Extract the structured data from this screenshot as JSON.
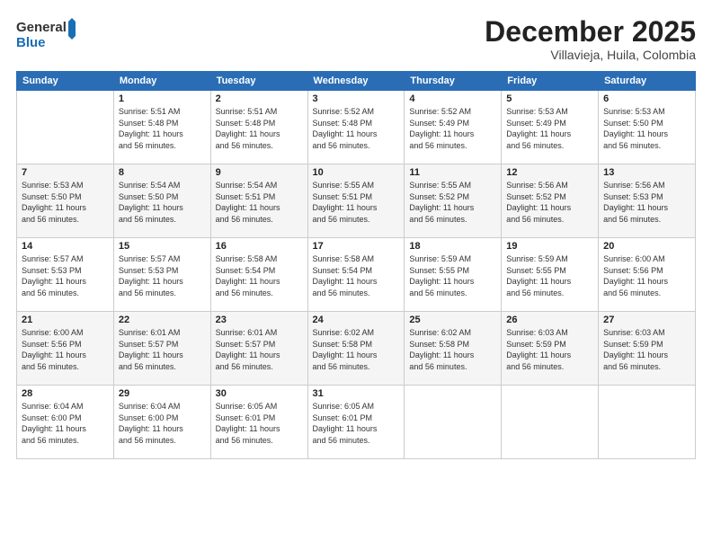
{
  "logo": {
    "line1": "General",
    "line2": "Blue"
  },
  "title": "December 2025",
  "subtitle": "Villavieja, Huila, Colombia",
  "weekdays": [
    "Sunday",
    "Monday",
    "Tuesday",
    "Wednesday",
    "Thursday",
    "Friday",
    "Saturday"
  ],
  "rows": [
    [
      {
        "day": "",
        "info": ""
      },
      {
        "day": "1",
        "info": "Sunrise: 5:51 AM\nSunset: 5:48 PM\nDaylight: 11 hours\nand 56 minutes."
      },
      {
        "day": "2",
        "info": "Sunrise: 5:51 AM\nSunset: 5:48 PM\nDaylight: 11 hours\nand 56 minutes."
      },
      {
        "day": "3",
        "info": "Sunrise: 5:52 AM\nSunset: 5:48 PM\nDaylight: 11 hours\nand 56 minutes."
      },
      {
        "day": "4",
        "info": "Sunrise: 5:52 AM\nSunset: 5:49 PM\nDaylight: 11 hours\nand 56 minutes."
      },
      {
        "day": "5",
        "info": "Sunrise: 5:53 AM\nSunset: 5:49 PM\nDaylight: 11 hours\nand 56 minutes."
      },
      {
        "day": "6",
        "info": "Sunrise: 5:53 AM\nSunset: 5:50 PM\nDaylight: 11 hours\nand 56 minutes."
      }
    ],
    [
      {
        "day": "7",
        "info": "Sunrise: 5:53 AM\nSunset: 5:50 PM\nDaylight: 11 hours\nand 56 minutes."
      },
      {
        "day": "8",
        "info": "Sunrise: 5:54 AM\nSunset: 5:50 PM\nDaylight: 11 hours\nand 56 minutes."
      },
      {
        "day": "9",
        "info": "Sunrise: 5:54 AM\nSunset: 5:51 PM\nDaylight: 11 hours\nand 56 minutes."
      },
      {
        "day": "10",
        "info": "Sunrise: 5:55 AM\nSunset: 5:51 PM\nDaylight: 11 hours\nand 56 minutes."
      },
      {
        "day": "11",
        "info": "Sunrise: 5:55 AM\nSunset: 5:52 PM\nDaylight: 11 hours\nand 56 minutes."
      },
      {
        "day": "12",
        "info": "Sunrise: 5:56 AM\nSunset: 5:52 PM\nDaylight: 11 hours\nand 56 minutes."
      },
      {
        "day": "13",
        "info": "Sunrise: 5:56 AM\nSunset: 5:53 PM\nDaylight: 11 hours\nand 56 minutes."
      }
    ],
    [
      {
        "day": "14",
        "info": "Sunrise: 5:57 AM\nSunset: 5:53 PM\nDaylight: 11 hours\nand 56 minutes."
      },
      {
        "day": "15",
        "info": "Sunrise: 5:57 AM\nSunset: 5:53 PM\nDaylight: 11 hours\nand 56 minutes."
      },
      {
        "day": "16",
        "info": "Sunrise: 5:58 AM\nSunset: 5:54 PM\nDaylight: 11 hours\nand 56 minutes."
      },
      {
        "day": "17",
        "info": "Sunrise: 5:58 AM\nSunset: 5:54 PM\nDaylight: 11 hours\nand 56 minutes."
      },
      {
        "day": "18",
        "info": "Sunrise: 5:59 AM\nSunset: 5:55 PM\nDaylight: 11 hours\nand 56 minutes."
      },
      {
        "day": "19",
        "info": "Sunrise: 5:59 AM\nSunset: 5:55 PM\nDaylight: 11 hours\nand 56 minutes."
      },
      {
        "day": "20",
        "info": "Sunrise: 6:00 AM\nSunset: 5:56 PM\nDaylight: 11 hours\nand 56 minutes."
      }
    ],
    [
      {
        "day": "21",
        "info": "Sunrise: 6:00 AM\nSunset: 5:56 PM\nDaylight: 11 hours\nand 56 minutes."
      },
      {
        "day": "22",
        "info": "Sunrise: 6:01 AM\nSunset: 5:57 PM\nDaylight: 11 hours\nand 56 minutes."
      },
      {
        "day": "23",
        "info": "Sunrise: 6:01 AM\nSunset: 5:57 PM\nDaylight: 11 hours\nand 56 minutes."
      },
      {
        "day": "24",
        "info": "Sunrise: 6:02 AM\nSunset: 5:58 PM\nDaylight: 11 hours\nand 56 minutes."
      },
      {
        "day": "25",
        "info": "Sunrise: 6:02 AM\nSunset: 5:58 PM\nDaylight: 11 hours\nand 56 minutes."
      },
      {
        "day": "26",
        "info": "Sunrise: 6:03 AM\nSunset: 5:59 PM\nDaylight: 11 hours\nand 56 minutes."
      },
      {
        "day": "27",
        "info": "Sunrise: 6:03 AM\nSunset: 5:59 PM\nDaylight: 11 hours\nand 56 minutes."
      }
    ],
    [
      {
        "day": "28",
        "info": "Sunrise: 6:04 AM\nSunset: 6:00 PM\nDaylight: 11 hours\nand 56 minutes."
      },
      {
        "day": "29",
        "info": "Sunrise: 6:04 AM\nSunset: 6:00 PM\nDaylight: 11 hours\nand 56 minutes."
      },
      {
        "day": "30",
        "info": "Sunrise: 6:05 AM\nSunset: 6:01 PM\nDaylight: 11 hours\nand 56 minutes."
      },
      {
        "day": "31",
        "info": "Sunrise: 6:05 AM\nSunset: 6:01 PM\nDaylight: 11 hours\nand 56 minutes."
      },
      {
        "day": "",
        "info": ""
      },
      {
        "day": "",
        "info": ""
      },
      {
        "day": "",
        "info": ""
      }
    ]
  ]
}
